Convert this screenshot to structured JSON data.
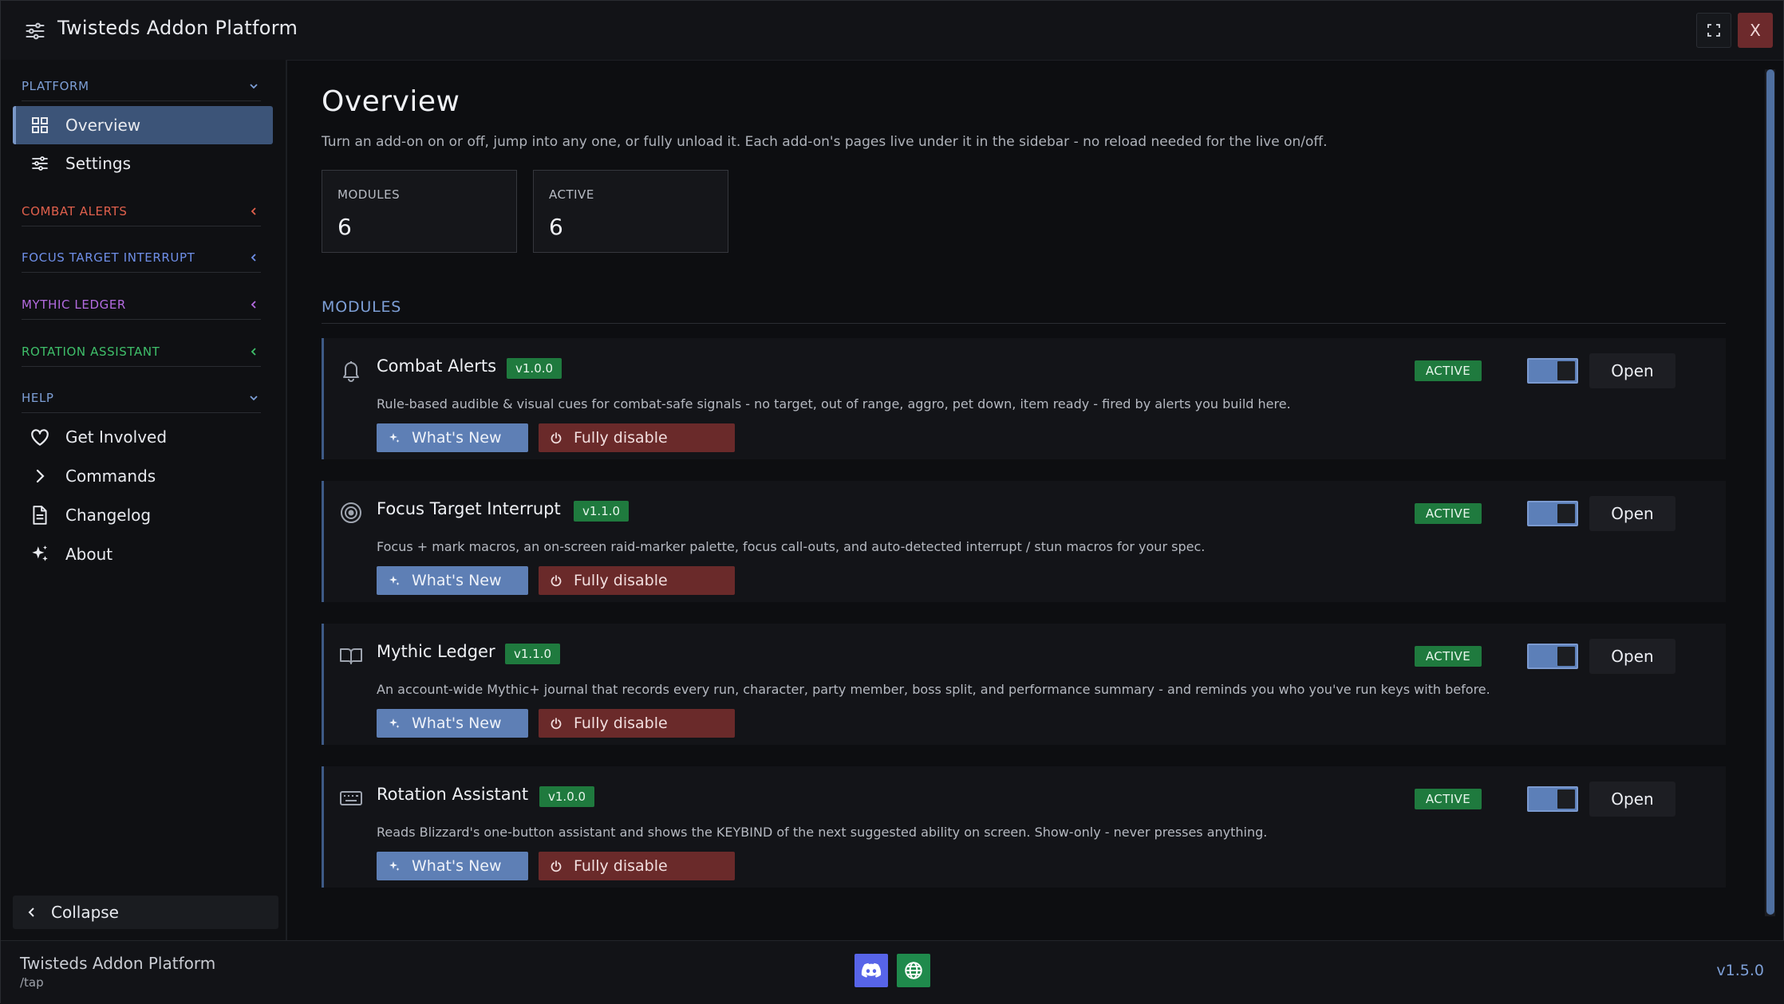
{
  "window": {
    "title": "Twisteds Addon Platform",
    "close_label": "X",
    "icons": {
      "app": "sliders-icon",
      "maximize": "maximize-icon"
    }
  },
  "sidebar": {
    "sections": [
      {
        "label": "PLATFORM",
        "color": "#7d9fd6",
        "state": "expanded"
      },
      {
        "label": "COMBAT ALERTS",
        "color": "#e0604c",
        "state": "collapsed"
      },
      {
        "label": "FOCUS TARGET INTERRUPT",
        "color": "#6f8fe8",
        "state": "collapsed"
      },
      {
        "label": "MYTHIC LEDGER",
        "color": "#b46be0",
        "state": "collapsed"
      },
      {
        "label": "ROTATION ASSISTANT",
        "color": "#3fbf6a",
        "state": "collapsed"
      },
      {
        "label": "HELP",
        "color": "#7d9fd6",
        "state": "expanded"
      }
    ],
    "platform_items": [
      {
        "label": "Overview",
        "icon": "grid-icon",
        "active": true
      },
      {
        "label": "Settings",
        "icon": "sliders-icon",
        "active": false
      }
    ],
    "help_items": [
      {
        "label": "Get Involved",
        "icon": "heart-icon"
      },
      {
        "label": "Commands",
        "icon": "chevron-right-icon"
      },
      {
        "label": "Changelog",
        "icon": "document-icon"
      },
      {
        "label": "About",
        "icon": "sparkles-icon"
      }
    ],
    "collapse_label": "Collapse"
  },
  "main": {
    "title": "Overview",
    "description": "Turn an add-on on or off, jump into any one, or fully unload it. Each add-on's pages live under it in the sidebar - no reload needed for the live on/off.",
    "stats": [
      {
        "label": "MODULES",
        "value": "6"
      },
      {
        "label": "ACTIVE",
        "value": "6"
      }
    ],
    "modules_heading": "MODULES",
    "modules": [
      {
        "name": "Combat Alerts",
        "version": "v1.0.0",
        "icon": "bell-icon",
        "description": "Rule-based audible & visual cues for combat-safe signals - no target, out of range, aggro, pet down, item ready - fired by alerts you build here.",
        "status": "ACTIVE",
        "enabled": true,
        "whats_new_label": "What's New",
        "disable_label": "Fully disable",
        "open_label": "Open"
      },
      {
        "name": "Focus Target Interrupt",
        "version": "v1.1.0",
        "icon": "target-icon",
        "description": "Focus + mark macros, an on-screen raid-marker palette, focus call-outs, and auto-detected interrupt / stun macros for your spec.",
        "status": "ACTIVE",
        "enabled": true,
        "whats_new_label": "What's New",
        "disable_label": "Fully disable",
        "open_label": "Open"
      },
      {
        "name": "Mythic Ledger",
        "version": "v1.1.0",
        "icon": "book-icon",
        "description": "An account-wide Mythic+ journal that records every run, character, party member, boss split, and performance summary - and reminds you who you've run keys with before.",
        "status": "ACTIVE",
        "enabled": true,
        "whats_new_label": "What's New",
        "disable_label": "Fully disable",
        "open_label": "Open"
      },
      {
        "name": "Rotation Assistant",
        "version": "v1.0.0",
        "icon": "keyboard-icon",
        "description": "Reads Blizzard's one-button assistant and shows the KEYBIND of the next suggested ability on screen. Show-only - never presses anything.",
        "status": "ACTIVE",
        "enabled": true,
        "whats_new_label": "What's New",
        "disable_label": "Fully disable",
        "open_label": "Open"
      }
    ]
  },
  "footer": {
    "name": "Twisteds Addon Platform",
    "command": "/tap",
    "version": "v1.5.0",
    "icons": {
      "discord": "discord-icon",
      "web": "globe-icon"
    }
  },
  "colors": {
    "accent": "#5e7fb5",
    "active_green": "#1f7a3e",
    "danger": "#6a2a2a",
    "discord": "#5764e8"
  }
}
